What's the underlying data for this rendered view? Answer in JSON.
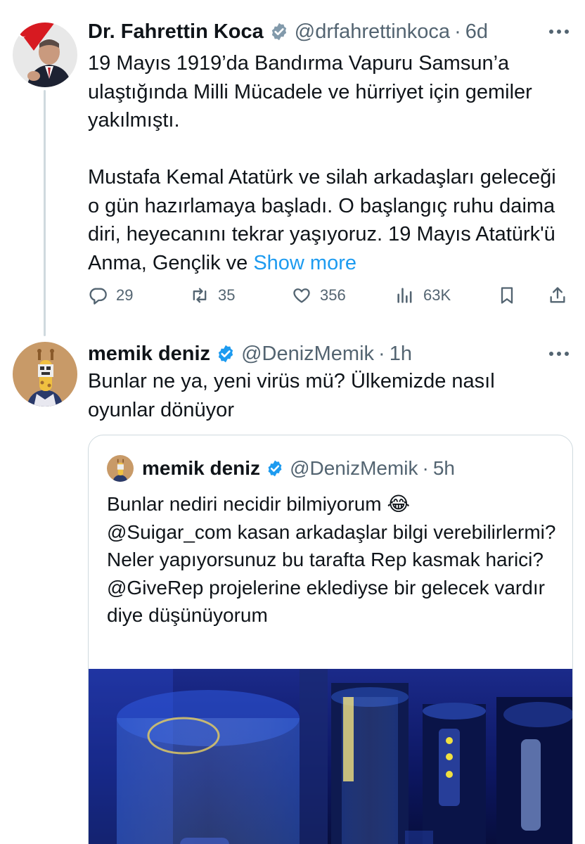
{
  "tweet1": {
    "name": "Dr. Fahrettin Koca",
    "handle": "@drfahrettinkoca",
    "separator": "·",
    "time": "6d",
    "text_p1": "19 Mayıs 1919’da Bandırma Vapuru Samsun’a ulaştığında Milli Mücadele ve hürriyet için gemiler yakılmıştı.",
    "text_p2": "Mustafa Kemal Atatürk ve silah arkadaşları geleceği o gün hazırlamaya başladı. O başlangıç ruhu daima diri, heyecanını tekrar yaşıyoruz. 19 Mayıs Atatürk'ü Anma, Gençlik ve",
    "show_more": "Show more",
    "replies": "29",
    "retweets": "35",
    "likes": "356",
    "views": "63K"
  },
  "tweet2": {
    "name": "memik deniz",
    "handle": "@DenizMemik",
    "separator": "·",
    "time": "1h",
    "text": "Bunlar ne ya, yeni virüs mü? Ülkemizde nasıl oyunlar dönüyor"
  },
  "quote": {
    "name": "memik deniz",
    "handle": "@DenizMemik",
    "separator": "·",
    "time": "5h",
    "text": "Bunlar nediri necidir bilmiyorum 😂\n@Suigar_com kasan arkadaşlar bilgi verebilirlermi? Neler yapıyorsunuz bu tarafta Rep kasmak harici?\n@GiveRep projelerine eklediyse bir gelecek vardır diye düşünüyorum"
  },
  "icons": {
    "verified": "verified-badge-icon",
    "more": "more-options-icon",
    "reply": "reply-icon",
    "retweet": "retweet-icon",
    "like": "heart-icon",
    "views": "views-icon",
    "bookmark": "bookmark-icon",
    "share": "share-icon"
  },
  "colors": {
    "link": "#1d9bf0",
    "secondary_text": "#536471",
    "primary_text": "#0f1419",
    "border": "#cfd9de"
  }
}
